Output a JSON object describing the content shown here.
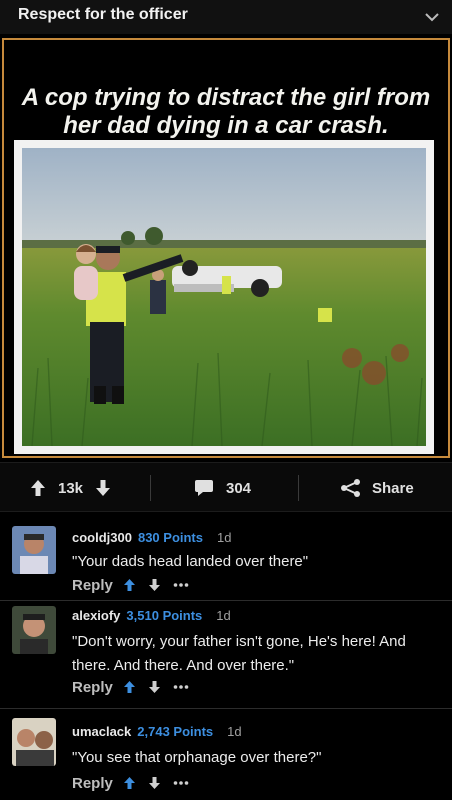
{
  "header": {
    "title": "Respect for the officer",
    "chevron_icon": "chevron-down-icon"
  },
  "post": {
    "headline": [
      "A cop trying to distract the girl from",
      "her dad dying in a car crash."
    ],
    "border_color": "#c68a3c"
  },
  "actions": {
    "upvotes": "13k",
    "comments": "304",
    "share": "Share"
  },
  "comments": [
    {
      "user": "cooldj300",
      "points": "830 Points",
      "age": "1d",
      "text": [
        "\"Your dads head landed over there\""
      ],
      "reply": "Reply"
    },
    {
      "user": "alexiofy",
      "points": "3,510 Points",
      "age": "1d",
      "text": [
        "\"Don't worry, your father isn't gone, He's here! And",
        "there. And there. And over there.\""
      ],
      "reply": "Reply"
    },
    {
      "user": "umaclack",
      "points": "2,743 Points",
      "age": "1d",
      "text": [
        "\"You see that orphanage over there?\""
      ],
      "reply": "Reply"
    }
  ],
  "colors": {
    "points": "#3d8fe0",
    "upvote_active": "#3d8fe0"
  }
}
